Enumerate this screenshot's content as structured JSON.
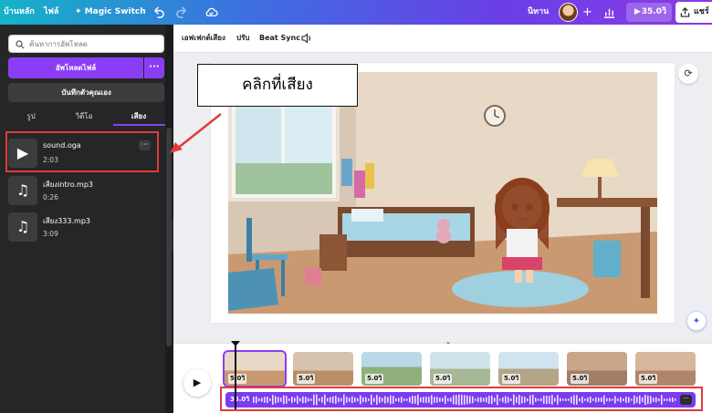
{
  "topbar": {
    "home": "บ้านหลัก",
    "file": "ไฟล์",
    "magic_switch": "Magic Switch",
    "user_name": "นิทาน",
    "play_time": "35.0วิ",
    "share": "แชร์"
  },
  "left_panel": {
    "search_placeholder": "ค้นหาการอัพโหลด",
    "upload_button": "อัพโหลดไฟล์",
    "upload_more": "···",
    "record_button": "บันทึกตัวคุณเอง",
    "tabs": [
      {
        "label": "รูป"
      },
      {
        "label": "วิดีโอ"
      },
      {
        "label": "เสียง"
      }
    ],
    "audio_items": [
      {
        "name": "sound.oga",
        "duration": "2:03"
      },
      {
        "name": "เสียงintro.mp3",
        "duration": "0:26"
      },
      {
        "name": "เสียง333.mp3",
        "duration": "3:09"
      }
    ],
    "item_more": "···"
  },
  "subtoolbar": {
    "effects": "เอฟเฟกต์เสียง",
    "adjust": "ปรับ",
    "beat_sync": "Beat Sync"
  },
  "callout": {
    "text": "คลิกที่เสียง"
  },
  "timeline": {
    "clips": [
      {
        "duration": "5.0วิ"
      },
      {
        "duration": "5.0วิ"
      },
      {
        "duration": "5.0วิ"
      },
      {
        "duration": "5.0วิ"
      },
      {
        "duration": "5.0วิ"
      },
      {
        "duration": "5.0วิ"
      },
      {
        "duration": "5.0วิ"
      }
    ],
    "audio_track_label": "35.0วิ",
    "audio_track_more": "···"
  },
  "colors": {
    "accent": "#8b3df5",
    "highlight": "#e23a3a",
    "panel": "#252627"
  }
}
